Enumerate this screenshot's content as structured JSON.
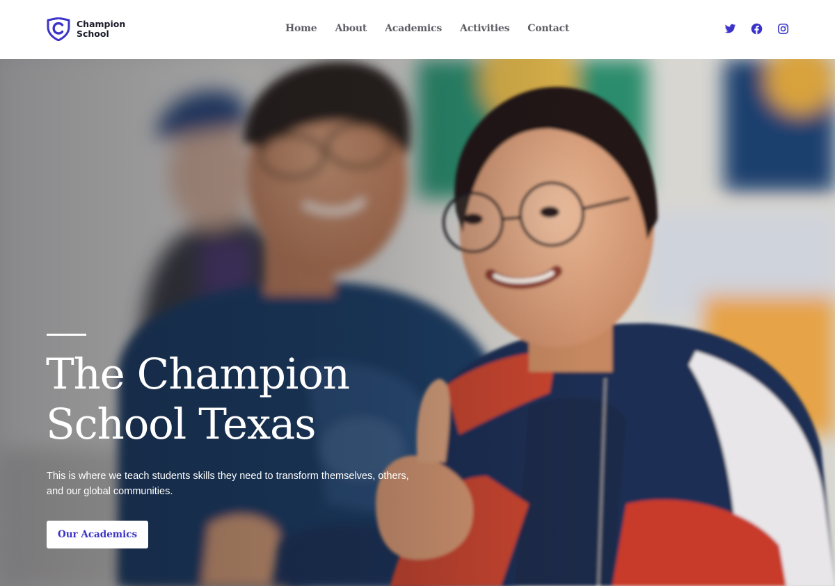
{
  "brand": {
    "line1": "Champion",
    "line2": "School",
    "logo_icon": "shield-c-logo",
    "accent_color": "#3b33c9"
  },
  "nav": {
    "items": [
      {
        "label": "Home"
      },
      {
        "label": "About"
      },
      {
        "label": "Academics"
      },
      {
        "label": "Activities"
      },
      {
        "label": "Contact"
      }
    ]
  },
  "social": {
    "icons": [
      "twitter-icon",
      "facebook-icon",
      "instagram-icon"
    ],
    "color": "#3b33c9"
  },
  "hero": {
    "title_line1": "The Champion",
    "title_line2": "School Texas",
    "description": "This is where we teach students skills they need to transform themselves, others, and our global communities.",
    "cta_label": "Our Academics"
  }
}
